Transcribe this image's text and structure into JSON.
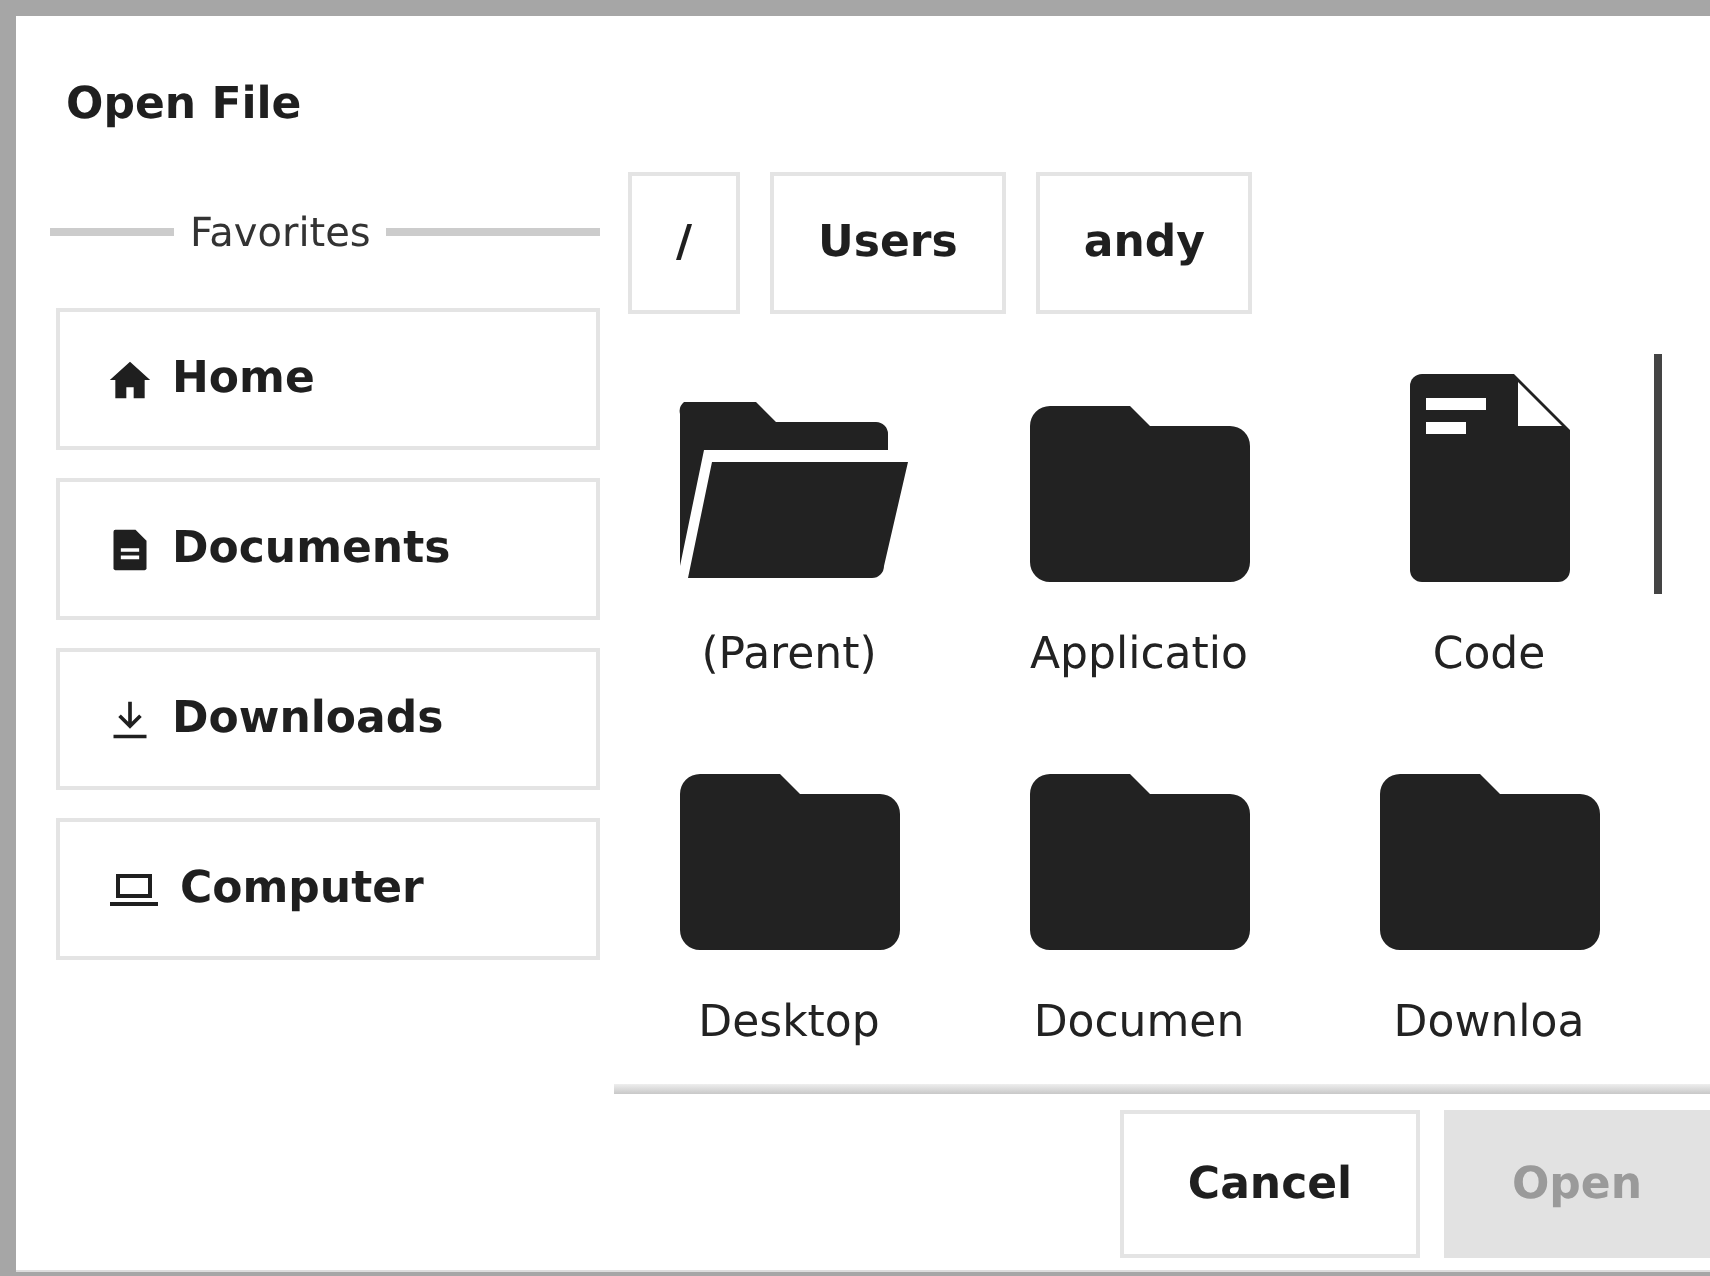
{
  "window": {
    "title": "Open File"
  },
  "sidebar": {
    "heading": "Favorites",
    "items": [
      {
        "label": "Home",
        "kind": "home"
      },
      {
        "label": "Documents",
        "kind": "document"
      },
      {
        "label": "Downloads",
        "kind": "download"
      },
      {
        "label": "Computer",
        "kind": "computer"
      }
    ]
  },
  "path": [
    "/",
    "Users",
    "andy"
  ],
  "files": [
    {
      "name": "(Parent)",
      "kind": "parent"
    },
    {
      "name": "Applicatio",
      "kind": "folder"
    },
    {
      "name": "Code",
      "kind": "file"
    },
    {
      "name": "Desktop",
      "kind": "folder"
    },
    {
      "name": "Documen",
      "kind": "folder"
    },
    {
      "name": "Downloa",
      "kind": "folder"
    }
  ],
  "buttons": [
    {
      "label": "Cancel",
      "disabled": false
    },
    {
      "label": "Open",
      "disabled": true
    }
  ]
}
